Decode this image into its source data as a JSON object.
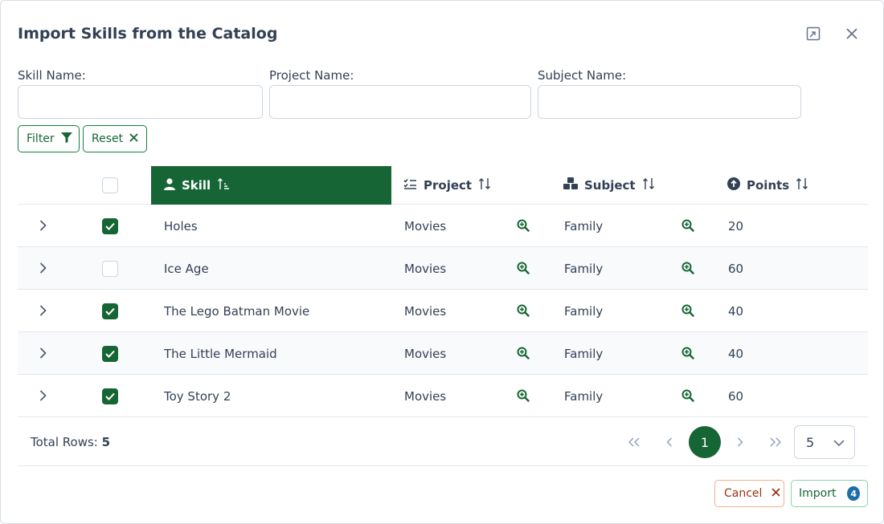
{
  "dialog": {
    "title": "Import Skills from the Catalog",
    "maximize_icon": "window-maximize-icon",
    "close_icon": "close-icon"
  },
  "filters": {
    "skill_label": "Skill Name:",
    "skill_value": "",
    "project_label": "Project Name:",
    "project_value": "",
    "subject_label": "Subject Name:",
    "subject_value": "",
    "filter_button": "Filter",
    "reset_button": "Reset"
  },
  "table": {
    "columns": {
      "skill": "Skill",
      "project": "Project",
      "subject": "Subject",
      "points": "Points"
    },
    "header_checkbox_checked": false,
    "rows": [
      {
        "skill": "Holes",
        "project": "Movies",
        "subject": "Family",
        "points": "20",
        "checked": true
      },
      {
        "skill": "Ice Age",
        "project": "Movies",
        "subject": "Family",
        "points": "60",
        "checked": false
      },
      {
        "skill": "The Lego Batman Movie",
        "project": "Movies",
        "subject": "Family",
        "points": "40",
        "checked": true
      },
      {
        "skill": "The Little Mermaid",
        "project": "Movies",
        "subject": "Family",
        "points": "40",
        "checked": true
      },
      {
        "skill": "Toy Story 2",
        "project": "Movies",
        "subject": "Family",
        "points": "60",
        "checked": true
      }
    ]
  },
  "pagination": {
    "total_label": "Total Rows:",
    "total_value": "5",
    "current_page": "1",
    "rows_per_page": "5"
  },
  "actions": {
    "cancel_label": "Cancel",
    "import_label": "Import",
    "import_count": "4"
  },
  "colors": {
    "primary": "#166534",
    "cancel": "#9a3412",
    "badge": "#1d6fa5"
  }
}
